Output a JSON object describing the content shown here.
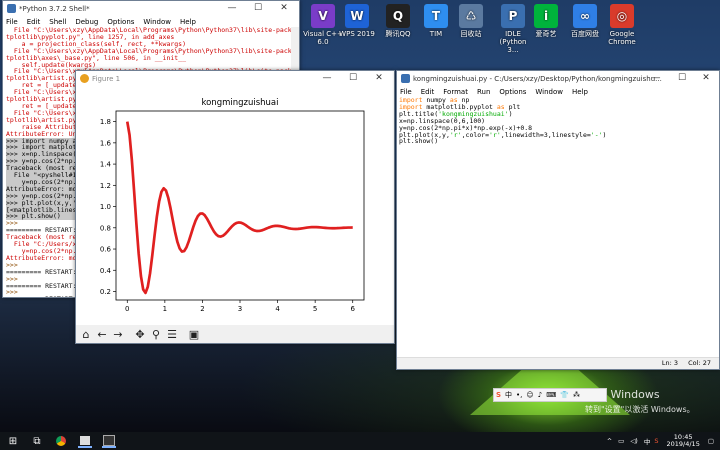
{
  "desktop_icons": [
    {
      "label": "Visual C++ 6.0",
      "color": "#7a3cc8",
      "glyph": "V"
    },
    {
      "label": "WPS 2019",
      "color": "#1e63d6",
      "glyph": "W"
    },
    {
      "label": "腾讯QQ",
      "color": "#222222",
      "glyph": "Q"
    },
    {
      "label": "TIM",
      "color": "#2e8ef0",
      "glyph": "T"
    },
    {
      "label": "回收站",
      "color": "#5b7aa0",
      "glyph": "♺"
    },
    {
      "label": "IDLE (Python 3...",
      "color": "#3a6fb0",
      "glyph": "P"
    },
    {
      "label": "爱奇艺",
      "color": "#00b33c",
      "glyph": "i"
    },
    {
      "label": "百度网盘",
      "color": "#2f7fe6",
      "glyph": "∞"
    },
    {
      "label": "Google Chrome",
      "color": "#d93b2b",
      "glyph": "◎"
    }
  ],
  "shell": {
    "title": "*Python 3.7.2 Shell*",
    "menu": [
      "File",
      "Edit",
      "Shell",
      "Debug",
      "Options",
      "Window",
      "Help"
    ],
    "lines": [
      {
        "t": "  File \"C:\\Users\\xzy\\AppData\\Local\\Programs\\Python\\Python37\\lib\\site-packages\\ma",
        "c": "err"
      },
      {
        "t": "tplotlib\\pyplot.py\", line 1257, in add_axes",
        "c": "err"
      },
      {
        "t": "    a = projection_class(self, rect, **kwargs)",
        "c": "err"
      },
      {
        "t": "  File \"C:\\Users\\xzy\\AppData\\Local\\Programs\\Python\\Python37\\lib\\site-packages\\ma",
        "c": "err"
      },
      {
        "t": "tplotlib\\axes\\_base.py\", line 506, in __init__",
        "c": "err"
      },
      {
        "t": "    self.update(kwargs)",
        "c": "err"
      },
      {
        "t": "  File \"C:\\Users\\xzy\\AppData\\Local\\Programs\\Python\\Python37\\lib\\site-packages\\ma",
        "c": "err"
      },
      {
        "t": "tplotlib\\artist.py\", line",
        "c": "err"
      },
      {
        "t": "    ret = [_update_pr",
        "c": "err"
      },
      {
        "t": "  File \"C:\\Users\\xzy\\",
        "c": "err"
      },
      {
        "t": "tplotlib\\artist.py\", l",
        "c": "err"
      },
      {
        "t": "    ret = [_update_pr",
        "c": "err"
      },
      {
        "t": "  File \"C:\\Users\\xzy\\",
        "c": "err"
      },
      {
        "t": "tplotlib\\artist.py\", l",
        "c": "err"
      },
      {
        "t": "    raise AttributeEr",
        "c": "err"
      },
      {
        "t": "AttributeError: Unkno",
        "c": "err"
      },
      {
        "t": ">>> import numpy as",
        "c": "hl"
      },
      {
        "t": ">>> import matplotli",
        "c": "hl"
      },
      {
        "t": ">>> x=np.linspace(0",
        "c": "hl"
      },
      {
        "t": ">>> y=np.cos(2*np.pi",
        "c": "hl"
      },
      {
        "t": "Traceback (most rece",
        "c": "hl"
      },
      {
        "t": "  File \"<pyshell#13>",
        "c": "hl"
      },
      {
        "t": "    y=np.cos(2*np.pi",
        "c": "hl"
      },
      {
        "t": "AttributeError: modu",
        "c": "hl"
      },
      {
        "t": ">>> y=np.cos(2*np.pi",
        "c": "hl"
      },
      {
        "t": ">>> plt.plot(x,y,'y",
        "c": "hl"
      },
      {
        "t": "[<matplotlib.lines.Li",
        "c": "hl"
      },
      {
        "t": ">>> plt.show()",
        "c": "hl"
      },
      {
        "t": ">>>",
        "c": "prm"
      },
      {
        "t": "========= RESTART: ",
        "c": "norm"
      },
      {
        "t": "Traceback (most rece",
        "c": "err"
      },
      {
        "t": "  File \"C:/Users/xzy",
        "c": "err"
      },
      {
        "t": "    y=np.cos(2*np.pi",
        "c": "err"
      },
      {
        "t": "AttributeError: modu",
        "c": "err"
      },
      {
        "t": ">>>",
        "c": "prm"
      },
      {
        "t": "========= RESTART: ",
        "c": "norm"
      },
      {
        "t": ">>>",
        "c": "prm"
      },
      {
        "t": "========= RESTART: ",
        "c": "norm"
      },
      {
        "t": ">>>",
        "c": "prm"
      },
      {
        "t": "========= RESTART: ",
        "c": "norm"
      }
    ]
  },
  "figure": {
    "title": "Figure 1",
    "chart_data": {
      "type": "line",
      "title": "kongmingzuishuai",
      "xlabel": "",
      "ylabel": "",
      "xlim": [
        -0.3,
        6.3
      ],
      "ylim": [
        0.12,
        1.9
      ],
      "xticks": [
        0,
        1,
        2,
        3,
        4,
        5,
        6
      ],
      "yticks": [
        0.2,
        0.4,
        0.6,
        0.8,
        1.0,
        1.2,
        1.4,
        1.6,
        1.8
      ],
      "function": "y = cos(2*pi*x) * exp(-x) + 0.8",
      "x_range": [
        0,
        6
      ],
      "num_points": 100,
      "line_color": "#e02020",
      "line_width": 3,
      "line_style": "-"
    },
    "toolbar": [
      "home",
      "back",
      "forward",
      "pan",
      "zoom",
      "configure",
      "save"
    ]
  },
  "editor": {
    "title": "kongmingzuishuai.py - C:/Users/xzy/Desktop/Python/kongmingzuishu...",
    "menu": [
      "File",
      "Edit",
      "Format",
      "Run",
      "Options",
      "Window",
      "Help"
    ],
    "code": [
      [
        {
          "t": "import",
          "c": "kw"
        },
        {
          "t": " numpy ",
          "c": ""
        },
        {
          "t": "as",
          "c": "kw"
        },
        {
          "t": " np",
          "c": ""
        }
      ],
      [
        {
          "t": "import",
          "c": "kw"
        },
        {
          "t": " matplotlib.pyplot ",
          "c": ""
        },
        {
          "t": "as",
          "c": "kw"
        },
        {
          "t": " plt",
          "c": ""
        }
      ],
      [
        {
          "t": "plt.title(",
          "c": ""
        },
        {
          "t": "'kongmingzuishuai'",
          "c": "str"
        },
        {
          "t": ")",
          "c": ""
        }
      ],
      [
        {
          "t": "x=np.linspace(0,6,100)",
          "c": ""
        }
      ],
      [
        {
          "t": "y=np.cos(2*np.pi*x)*np.exp(-x)+0.8",
          "c": ""
        }
      ],
      [
        {
          "t": "plt.plot(x,y,",
          "c": ""
        },
        {
          "t": "'r'",
          "c": "str"
        },
        {
          "t": ",color=",
          "c": ""
        },
        {
          "t": "'r'",
          "c": "str"
        },
        {
          "t": ",linewidth=3,linestyle=",
          "c": ""
        },
        {
          "t": "'-'",
          "c": "str"
        },
        {
          "t": ")",
          "c": ""
        }
      ],
      [
        {
          "t": "plt.show()",
          "c": ""
        }
      ]
    ],
    "status_line": "Ln: 3",
    "status_col": "Col: 27"
  },
  "activation": {
    "line1": "激活 Windows",
    "line2": "转到\"设置\"以激活 Windows。"
  },
  "ime": [
    "S",
    "中",
    "•,",
    "☺",
    "♪",
    "⌨",
    "👕",
    "⁂"
  ],
  "taskbar": {
    "time": "10:45",
    "date": "2019/4/15",
    "tray_text": "中",
    "apps": [
      "start",
      "taskview",
      "chrome",
      "idle",
      "figure"
    ]
  }
}
